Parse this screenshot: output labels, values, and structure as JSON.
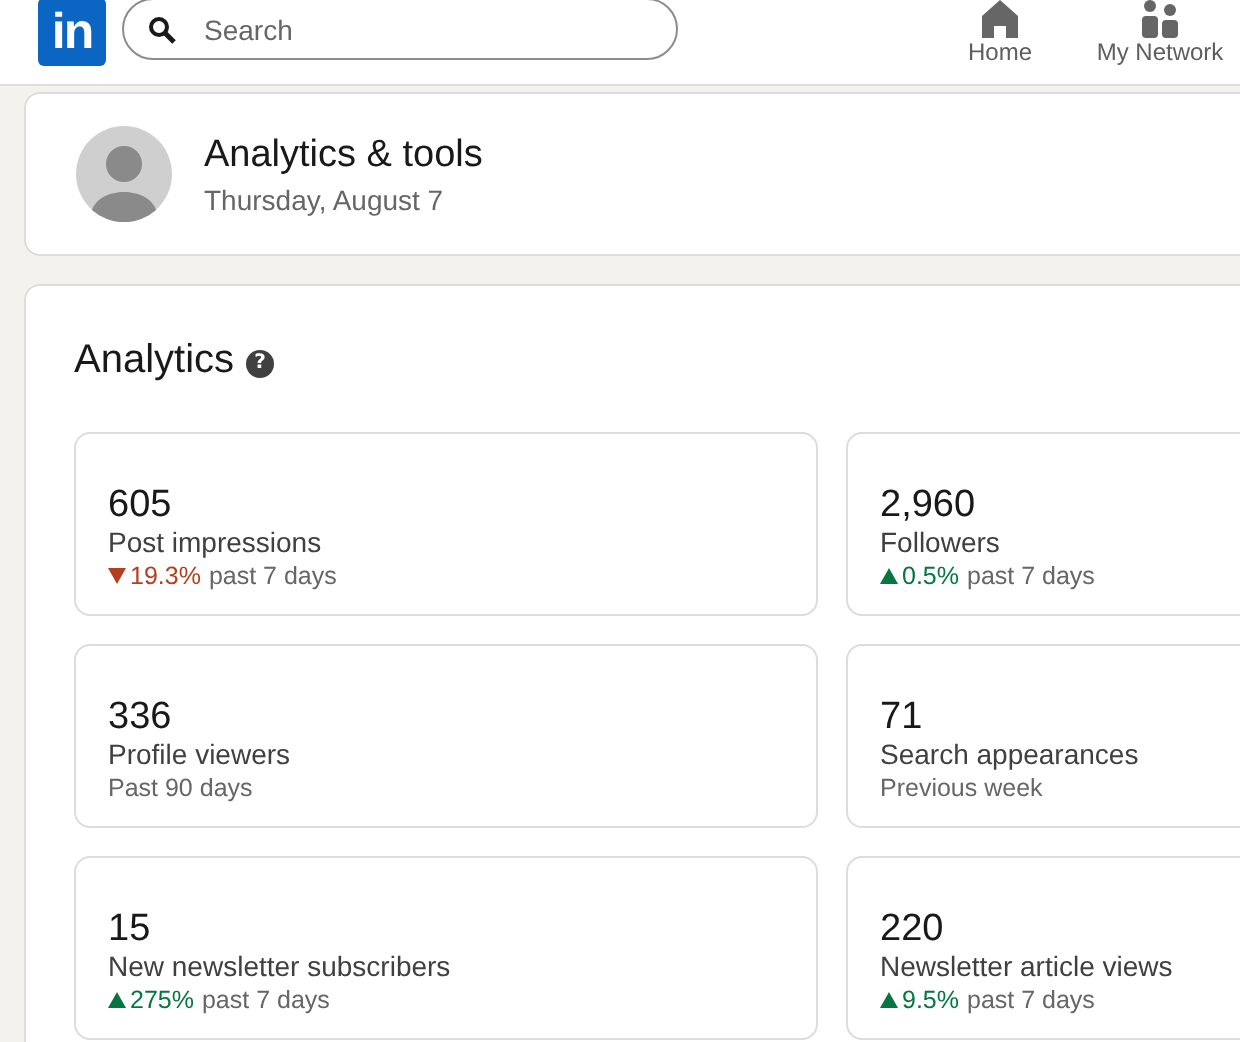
{
  "header": {
    "logo": "in",
    "search": {
      "placeholder": "Search"
    },
    "nav": [
      {
        "label": "Home",
        "kind": "home"
      },
      {
        "label": "My Network",
        "kind": "network"
      }
    ]
  },
  "profile": {
    "title": "Analytics & tools",
    "date": "Thursday, August 7"
  },
  "analytics": {
    "title": "Analytics",
    "help": "?",
    "cards": [
      {
        "value": "605",
        "label": "Post impressions",
        "trend": {
          "kind": "down",
          "change": "19.3%",
          "period": "past 7 days"
        }
      },
      {
        "value": "2,960",
        "label": "Followers",
        "trend": {
          "kind": "up",
          "change": "0.5%",
          "period": "past 7 days"
        }
      },
      {
        "value": "336",
        "label": "Profile viewers",
        "note": "Past 90 days"
      },
      {
        "value": "71",
        "label": "Search appearances",
        "note": "Previous week"
      },
      {
        "value": "15",
        "label": "New newsletter subscribers",
        "trend": {
          "kind": "up",
          "change": "275%",
          "period": "past 7 days"
        }
      },
      {
        "value": "220",
        "label": "Newsletter article views",
        "trend": {
          "kind": "up",
          "change": "9.5%",
          "period": "past 7 days"
        }
      }
    ]
  }
}
